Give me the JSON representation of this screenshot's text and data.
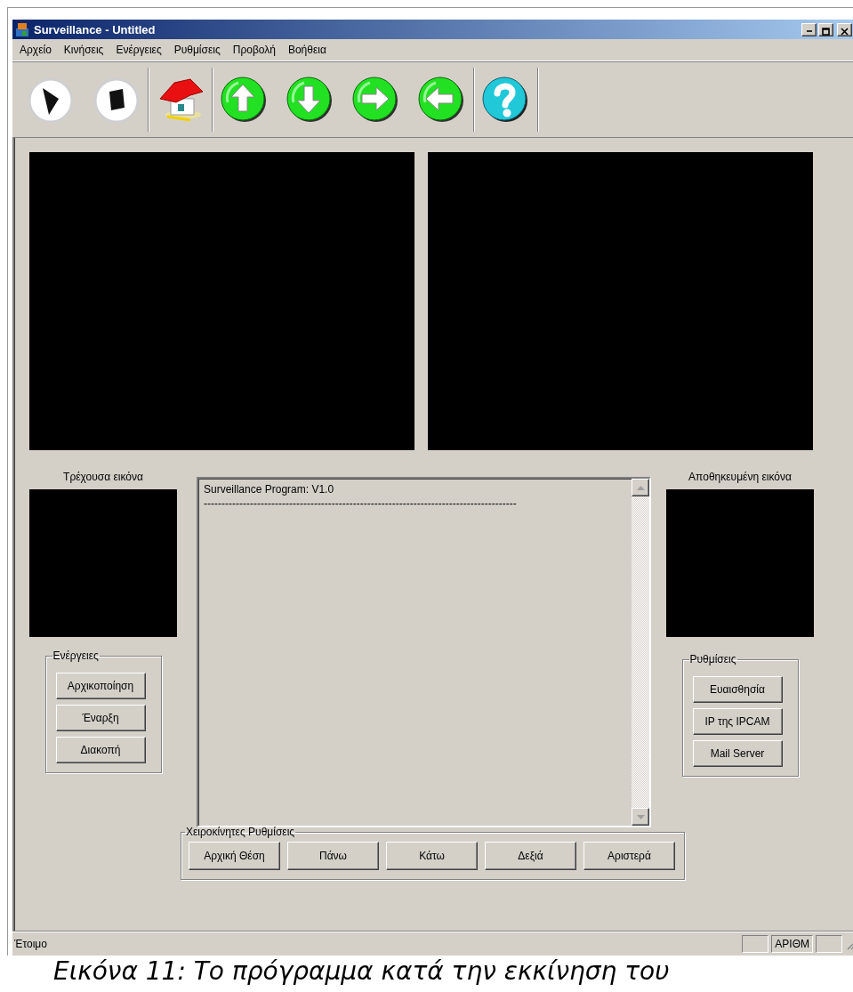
{
  "window": {
    "title": "Surveillance - Untitled"
  },
  "menu": [
    "Αρχείο",
    "Κινήσεις",
    "Ενέργειες",
    "Ρυθμίσεις",
    "Προβολή",
    "Βοήθεια"
  ],
  "toolbar": {
    "groups": [
      [
        {
          "kind": "play"
        },
        {
          "kind": "stop"
        }
      ],
      [
        {
          "kind": "home"
        }
      ],
      [
        {
          "kind": "up"
        },
        {
          "kind": "down"
        },
        {
          "kind": "right"
        },
        {
          "kind": "left"
        }
      ],
      [
        {
          "kind": "help"
        }
      ]
    ]
  },
  "current_image": {
    "label": "Τρέχουσα εικόνα"
  },
  "actions": {
    "title": "Ενέργειες",
    "buttons": [
      "Αρχικοποίηση",
      "Έναρξη",
      "Διακοπή"
    ]
  },
  "log": {
    "lines": [
      "Surveillance Program: V1.0",
      "----------------------------------------------------------------------------------------"
    ]
  },
  "saved_image": {
    "label": "Αποθηκευμένη εικόνα"
  },
  "settings": {
    "title": "Ρυθμίσεις",
    "buttons": [
      "Ευαισθησία",
      "IP της IPCAM",
      "Mail Server"
    ]
  },
  "manual": {
    "title": "Χειροκίνητες Ρυθμίσεις",
    "buttons": [
      "Αρχική Θέση",
      "Πάνω",
      "Κάτω",
      "Δεξιά",
      "Αριστερά"
    ]
  },
  "status_bar": {
    "message": "Έτοιμο",
    "indicators": [
      "ΑΡΙΘΜ"
    ]
  },
  "caption": "Εικόνα 11: Το πρόγραμμα κατά την εκκίνηση του"
}
